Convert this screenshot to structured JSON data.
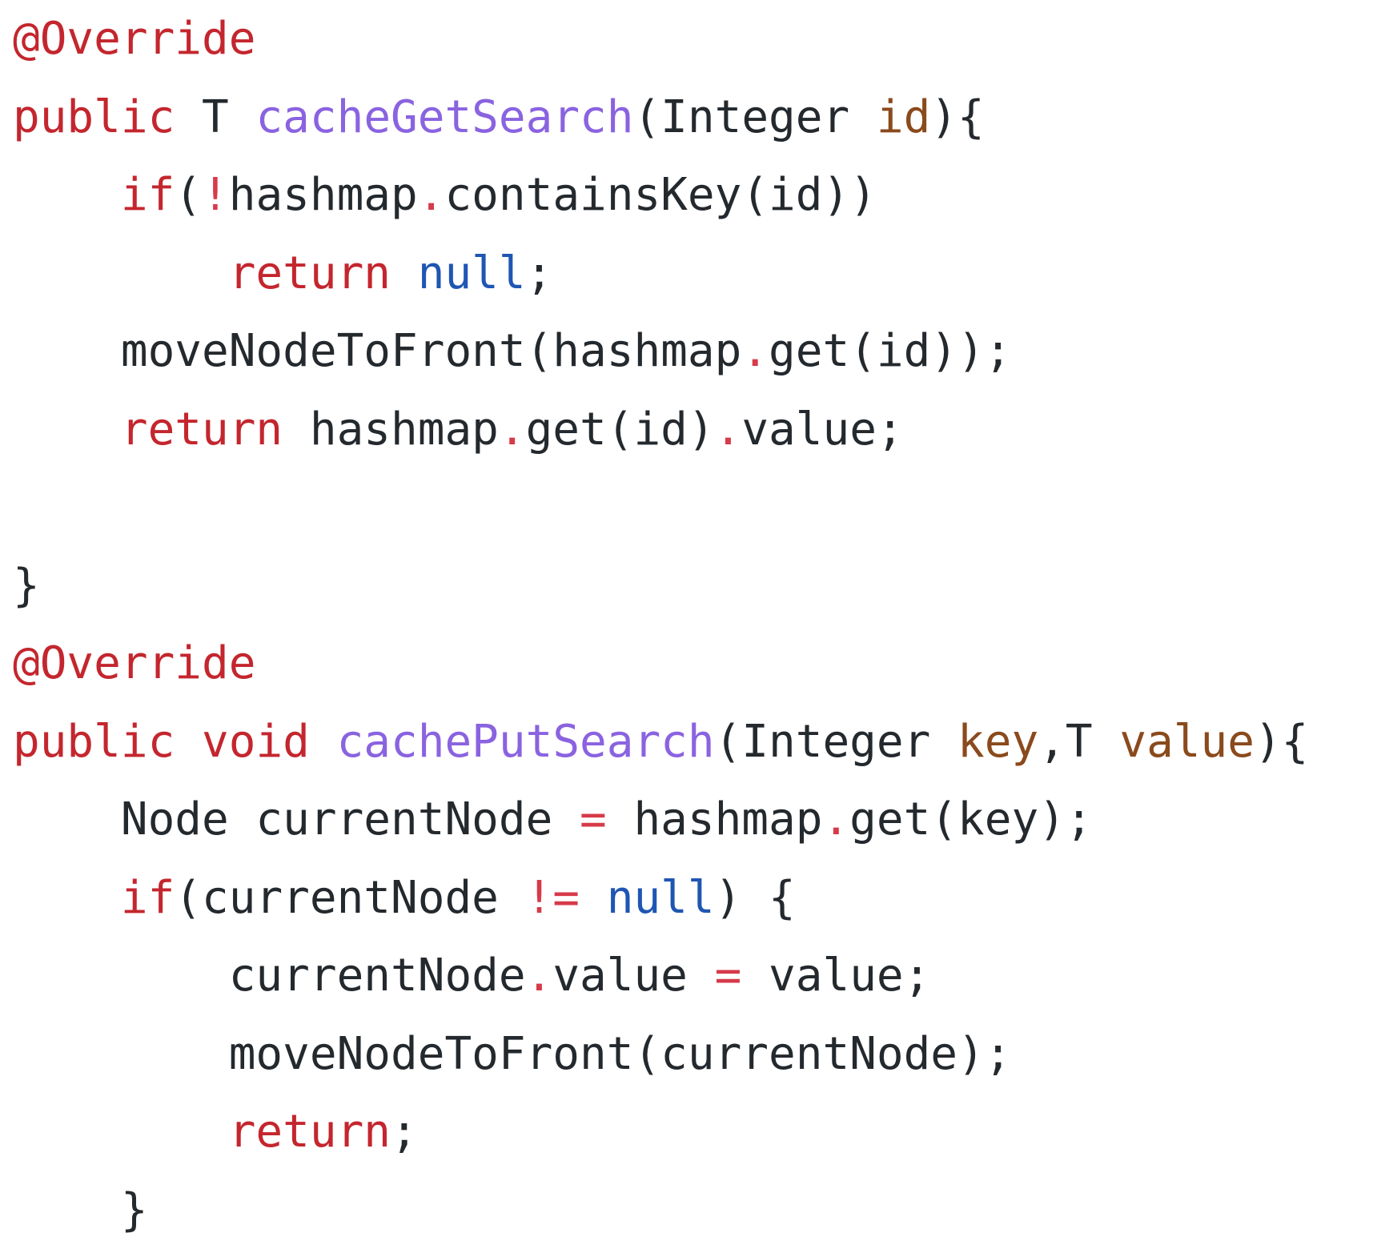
{
  "colors": {
    "keyword": "#c4262e",
    "function_name": "#8a63e0",
    "parameter": "#8a4a1c",
    "literal": "#1f56b3",
    "operator": "#d73a49",
    "plain": "#24292e",
    "background": "#ffffff"
  },
  "code": {
    "language": "java",
    "lines": [
      [
        {
          "t": "@Override",
          "c": "annotation"
        }
      ],
      [
        {
          "t": "public",
          "c": "keyword"
        },
        {
          "t": " T ",
          "c": "plain"
        },
        {
          "t": "cacheGetSearch",
          "c": "function"
        },
        {
          "t": "(Integer ",
          "c": "plain"
        },
        {
          "t": "id",
          "c": "param"
        },
        {
          "t": "){",
          "c": "plain"
        }
      ],
      [
        {
          "t": "    ",
          "c": "plain"
        },
        {
          "t": "if",
          "c": "keyword"
        },
        {
          "t": "(",
          "c": "plain"
        },
        {
          "t": "!",
          "c": "operator"
        },
        {
          "t": "hashmap",
          "c": "plain"
        },
        {
          "t": ".",
          "c": "operator"
        },
        {
          "t": "containsKey(id))",
          "c": "plain"
        }
      ],
      [
        {
          "t": "        ",
          "c": "plain"
        },
        {
          "t": "return",
          "c": "keyword"
        },
        {
          "t": " ",
          "c": "plain"
        },
        {
          "t": "null",
          "c": "literal"
        },
        {
          "t": ";",
          "c": "plain"
        }
      ],
      [
        {
          "t": "    moveNodeToFront(hashmap",
          "c": "plain"
        },
        {
          "t": ".",
          "c": "operator"
        },
        {
          "t": "get(id));",
          "c": "plain"
        }
      ],
      [
        {
          "t": "    ",
          "c": "plain"
        },
        {
          "t": "return",
          "c": "keyword"
        },
        {
          "t": " hashmap",
          "c": "plain"
        },
        {
          "t": ".",
          "c": "operator"
        },
        {
          "t": "get(id)",
          "c": "plain"
        },
        {
          "t": ".",
          "c": "operator"
        },
        {
          "t": "value;",
          "c": "plain"
        }
      ],
      [],
      [
        {
          "t": "}",
          "c": "plain"
        }
      ],
      [
        {
          "t": "@Override",
          "c": "annotation"
        }
      ],
      [
        {
          "t": "public",
          "c": "keyword"
        },
        {
          "t": " ",
          "c": "plain"
        },
        {
          "t": "void",
          "c": "keyword"
        },
        {
          "t": " ",
          "c": "plain"
        },
        {
          "t": "cachePutSearch",
          "c": "function"
        },
        {
          "t": "(Integer ",
          "c": "plain"
        },
        {
          "t": "key",
          "c": "param"
        },
        {
          "t": ",T ",
          "c": "plain"
        },
        {
          "t": "value",
          "c": "param"
        },
        {
          "t": "){",
          "c": "plain"
        }
      ],
      [
        {
          "t": "    Node currentNode ",
          "c": "plain"
        },
        {
          "t": "=",
          "c": "operator"
        },
        {
          "t": " hashmap",
          "c": "plain"
        },
        {
          "t": ".",
          "c": "operator"
        },
        {
          "t": "get(key);",
          "c": "plain"
        }
      ],
      [
        {
          "t": "    ",
          "c": "plain"
        },
        {
          "t": "if",
          "c": "keyword"
        },
        {
          "t": "(currentNode ",
          "c": "plain"
        },
        {
          "t": "!=",
          "c": "operator"
        },
        {
          "t": " ",
          "c": "plain"
        },
        {
          "t": "null",
          "c": "literal"
        },
        {
          "t": ") {",
          "c": "plain"
        }
      ],
      [
        {
          "t": "        currentNode",
          "c": "plain"
        },
        {
          "t": ".",
          "c": "operator"
        },
        {
          "t": "value ",
          "c": "plain"
        },
        {
          "t": "=",
          "c": "operator"
        },
        {
          "t": " value;",
          "c": "plain"
        }
      ],
      [
        {
          "t": "        moveNodeToFront(currentNode);",
          "c": "plain"
        }
      ],
      [
        {
          "t": "        ",
          "c": "plain"
        },
        {
          "t": "return",
          "c": "keyword"
        },
        {
          "t": ";",
          "c": "plain"
        }
      ],
      [
        {
          "t": "    }",
          "c": "plain"
        }
      ]
    ]
  }
}
